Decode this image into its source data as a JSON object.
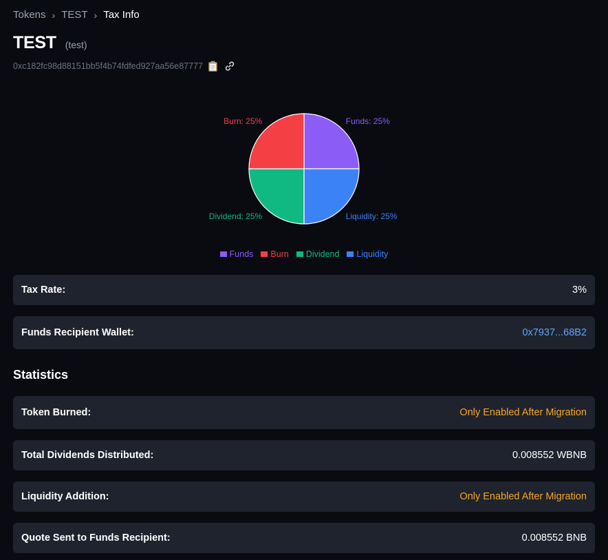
{
  "breadcrumb": {
    "items": [
      "Tokens",
      "TEST",
      "Tax Info"
    ],
    "separator": "›"
  },
  "token": {
    "name": "TEST",
    "symbol": "(test)",
    "address": "0xc182fc98d88151bb5f4b74fdfed927aa56e87777"
  },
  "icons": {
    "copy": "clipboard-icon",
    "link": "link-icon"
  },
  "chart_data": {
    "type": "pie",
    "slices": [
      {
        "name": "Funds",
        "value": 25,
        "label": "Funds: 25%",
        "color": "#8b5cf6"
      },
      {
        "name": "Liquidity",
        "value": 25,
        "label": "Liquidity: 25%",
        "color": "#3b82f6"
      },
      {
        "name": "Dividend",
        "value": 25,
        "label": "Dividend: 25%",
        "color": "#10b981"
      },
      {
        "name": "Burn",
        "value": 25,
        "label": "Burn: 25%",
        "color": "#f43f44"
      }
    ],
    "legend": [
      {
        "name": "Funds",
        "color": "#8b5cf6"
      },
      {
        "name": "Burn",
        "color": "#f43f44"
      },
      {
        "name": "Dividend",
        "color": "#10b981"
      },
      {
        "name": "Liquidity",
        "color": "#3b82f6"
      }
    ],
    "legend_position": "bottom"
  },
  "info": {
    "tax_rate_label": "Tax Rate:",
    "tax_rate_value": "3%",
    "funds_wallet_label": "Funds Recipient Wallet:",
    "funds_wallet_value": "0x7937...68B2"
  },
  "statistics": {
    "title": "Statistics",
    "token_burned_label": "Token Burned:",
    "token_burned_value": "Only Enabled After Migration",
    "dividends_label": "Total Dividends Distributed:",
    "dividends_value": "0.008552 WBNB",
    "liquidity_label": "Liquidity Addition:",
    "liquidity_value": "Only Enabled After Migration",
    "quote_label": "Quote Sent to Funds Recipient:",
    "quote_value": "0.008552 BNB"
  },
  "colors": {
    "background": "#090b11",
    "card": "#1e232d",
    "link": "#60a5fa",
    "warning": "#f5a623"
  }
}
